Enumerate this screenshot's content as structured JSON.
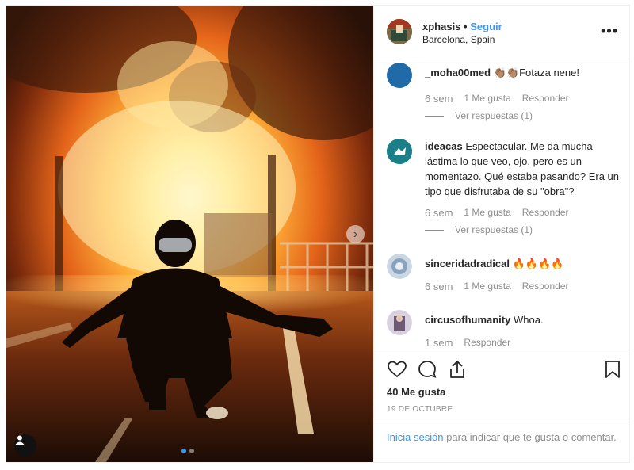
{
  "post": {
    "username": "xphasis",
    "separator": "•",
    "follow_label": "Seguir",
    "location": "Barcelona, Spain",
    "more_label": "•••",
    "likes": "40 Me gusta",
    "date": "19 DE OCTUBRE",
    "login_link": "Inicia sesión",
    "login_rest": " para indicar que te gusta o comentar.",
    "photo_description_icons": {
      "next": "chevron-right-icon",
      "tag": "user-tag-icon"
    },
    "carousel": {
      "count": 2,
      "active": 1
    }
  },
  "comments": [
    {
      "user": "_moha00med",
      "text": "👏🏽👏🏽Fotaza nene!",
      "time": "6 sem",
      "likes": "1 Me gusta",
      "reply": "Responder",
      "replies": "Ver respuestas (1)",
      "avatar_color": "#1f6aa7"
    },
    {
      "user": "ideacas",
      "text": "Espectacular. Me da mucha lástima lo que veo, ojo, pero es un momentazo. Qué estaba pasando? Era un tipo que disfrutaba de su \"obra\"?",
      "time": "6 sem",
      "likes": "1 Me gusta",
      "reply": "Responder",
      "replies": "Ver respuestas (1)",
      "avatar_color": "#1a8f86"
    },
    {
      "user": "sinceridadradical",
      "text": "🔥🔥🔥🔥",
      "time": "6 sem",
      "likes": "1 Me gusta",
      "reply": "Responder",
      "avatar_color": "#c9d6e4"
    },
    {
      "user": "circusofhumanity",
      "text": "Whoa.",
      "time": "1 sem",
      "reply": "Responder",
      "avatar_color": "#6e5a74"
    }
  ],
  "colors": {
    "link": "#3897f0",
    "muted": "#8e8e8e",
    "text": "#262626",
    "border": "#efefef"
  }
}
